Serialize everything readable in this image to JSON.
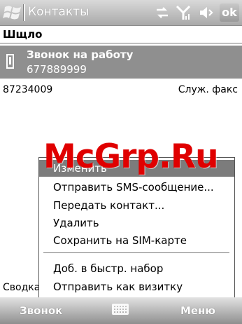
{
  "title_bar": {
    "app_title": "Контакты",
    "ok_label": "ok"
  },
  "contact": {
    "name": "Шщло"
  },
  "phones": [
    {
      "label": "Звонок на работу",
      "number": "677889999",
      "selected": true
    },
    {
      "number": "87234009",
      "type": "Служ. факс"
    }
  ],
  "summary_label": "Сводка",
  "context_menu": {
    "items": [
      {
        "label": "Изменить",
        "highlighted": true
      },
      {
        "label": "Отправить SMS-сообщение..."
      },
      {
        "label": "Передать контакт..."
      },
      {
        "label": "Удалить"
      },
      {
        "label": "Сохранить на SIM-карте"
      },
      {
        "label": "Доб. в быстр. набор"
      },
      {
        "label": "Отправить как визитку"
      }
    ]
  },
  "watermark": "McGrp.Ru",
  "bottom_bar": {
    "left_softkey": "Звонок",
    "right_softkey": "Меню"
  },
  "colors": {
    "selection": "#8f8f8f",
    "menu_highlight": "#7c7c7c",
    "watermark": "#e00000"
  }
}
